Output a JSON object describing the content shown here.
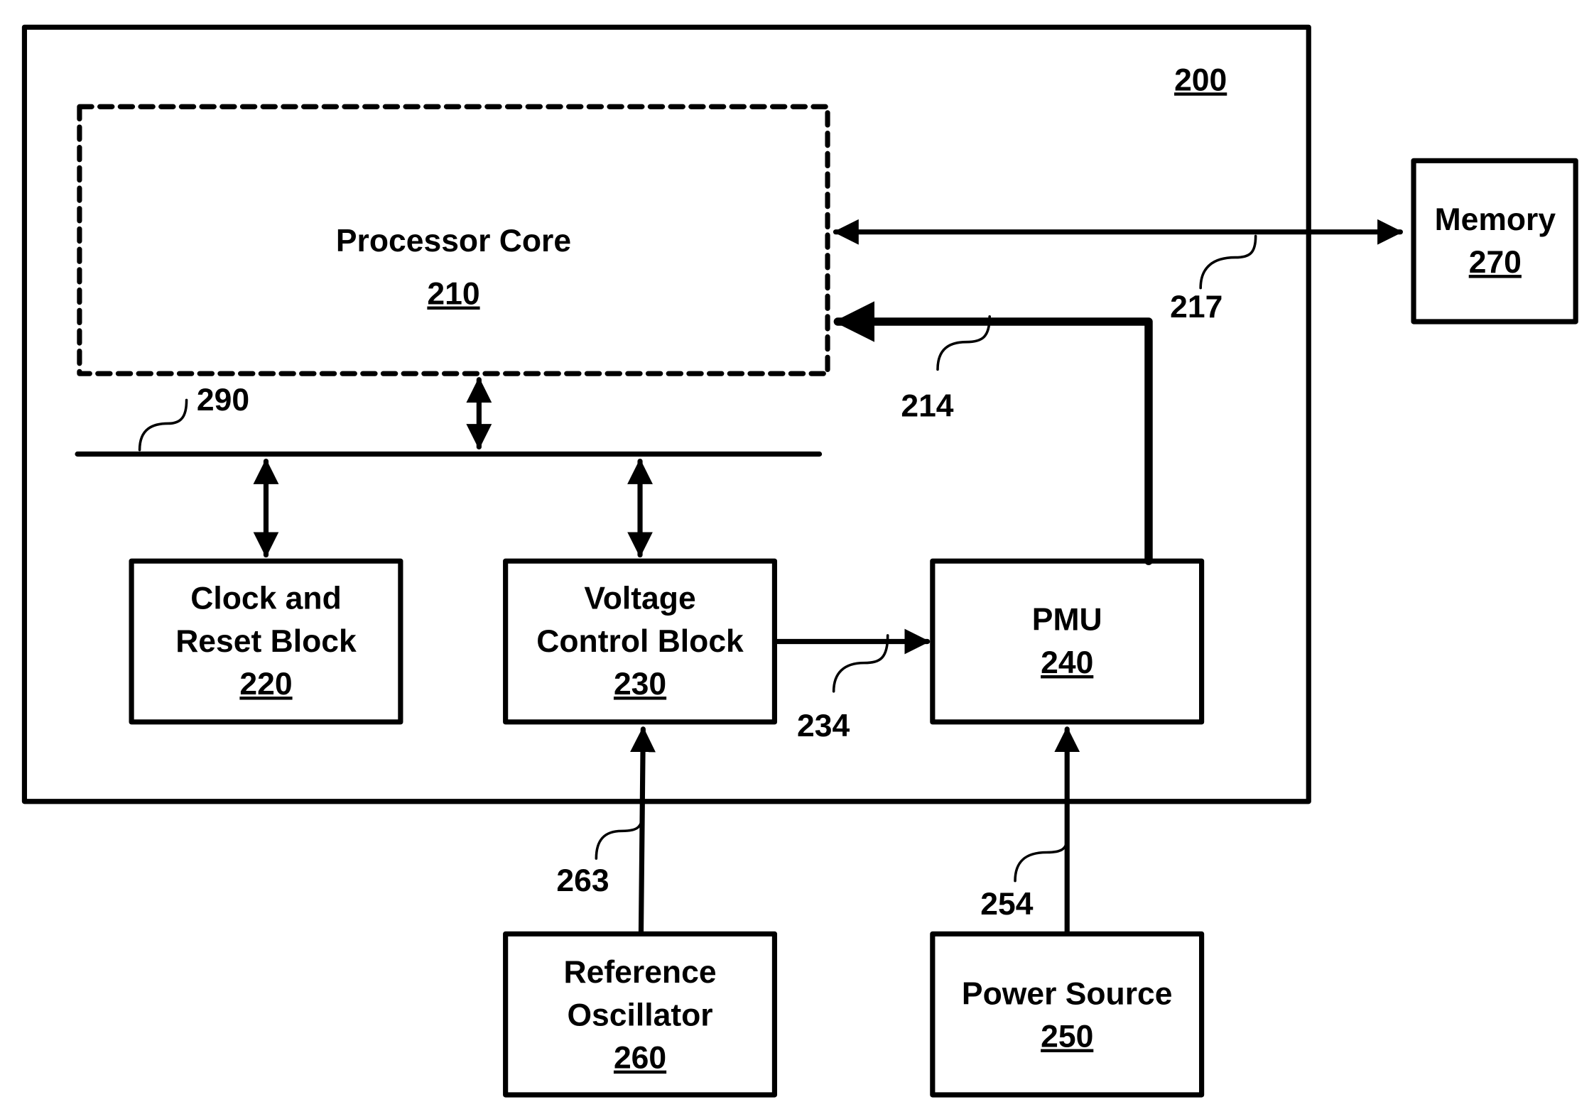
{
  "colors": {
    "ink": "#000000",
    "background": "#ffffff"
  },
  "system": {
    "ref": "200"
  },
  "blocks": {
    "processor_core": {
      "lines": [
        "Processor Core"
      ],
      "ref": "210",
      "style": "dashed"
    },
    "clock_reset": {
      "lines": [
        "Clock and",
        "Reset Block"
      ],
      "ref": "220"
    },
    "voltage_control": {
      "lines": [
        "Voltage",
        "Control Block"
      ],
      "ref": "230"
    },
    "pmu": {
      "lines": [
        "PMU"
      ],
      "ref": "240"
    },
    "power_source": {
      "lines": [
        "Power Source"
      ],
      "ref": "250"
    },
    "reference_oscillator": {
      "lines": [
        "Reference",
        "Oscillator"
      ],
      "ref": "260"
    },
    "memory": {
      "lines": [
        "Memory"
      ],
      "ref": "270"
    }
  },
  "connections": {
    "bus": {
      "ref": "290"
    },
    "pmu_to_core": {
      "ref": "214"
    },
    "core_memory": {
      "ref": "217"
    },
    "vcb_to_pmu": {
      "ref": "234"
    },
    "power_to_pmu": {
      "ref": "254"
    },
    "osc_to_vcb": {
      "ref": "263"
    }
  }
}
